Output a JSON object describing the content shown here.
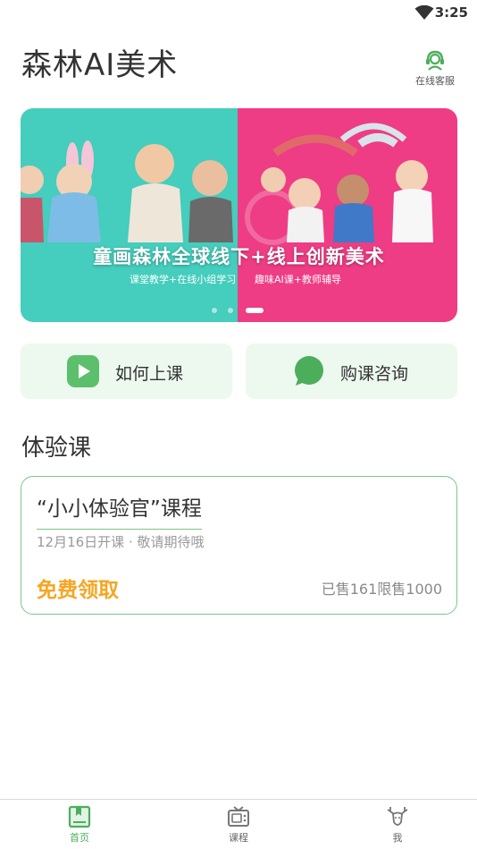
{
  "status_bar": {
    "time": "3:25"
  },
  "header": {
    "app_title": "森林AI美术",
    "support_label": "在线客服"
  },
  "banner": {
    "headline": "童画森林全球线下+线上创新美术",
    "sub_left": "课堂教学+在线小组学习",
    "sub_right": "趣味AI课+教师辅导",
    "slide_count": 3,
    "active_slide": 3
  },
  "quick_actions": [
    {
      "label": "如何上课",
      "icon": "play-icon"
    },
    {
      "label": "购课咨询",
      "icon": "chat-bubble-icon"
    }
  ],
  "trial_section": {
    "title": "体验课",
    "course": {
      "name": "“小小体验官”课程",
      "date_note": "12月16日开课 · 敬请期待哦",
      "cta": "免费领取",
      "sold_info": "已售161限售1000"
    }
  },
  "tabbar": [
    {
      "label": "首页",
      "icon": "book-icon",
      "active": true
    },
    {
      "label": "课程",
      "icon": "tv-icon",
      "active": false
    },
    {
      "label": "我",
      "icon": "deer-icon",
      "active": false
    }
  ],
  "colors": {
    "accent": "#4cae5b",
    "card_bg": "#edf8ef",
    "cta_orange": "#f5a623",
    "banner_teal": "#45cdbd",
    "banner_pink": "#ee3d84"
  }
}
